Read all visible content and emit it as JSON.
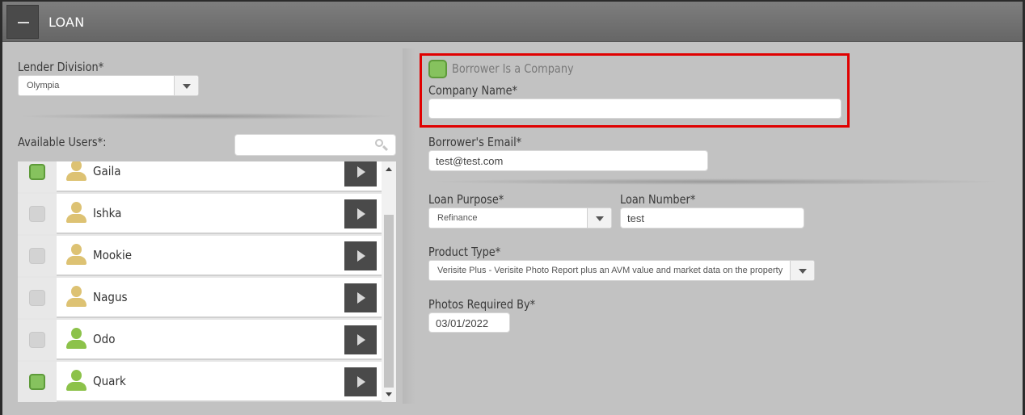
{
  "header": {
    "title": "LOAN",
    "collapse_icon": "minus-icon"
  },
  "lender_division": {
    "label": "Lender Division*",
    "value": "Olympia"
  },
  "available_users": {
    "label": "Available Users*:",
    "search_placeholder": "",
    "users": [
      {
        "name": "Gaila",
        "checked": true,
        "icon_color": "tan"
      },
      {
        "name": "Ishka",
        "checked": false,
        "icon_color": "tan"
      },
      {
        "name": "Mookie",
        "checked": false,
        "icon_color": "tan"
      },
      {
        "name": "Nagus",
        "checked": false,
        "icon_color": "tan"
      },
      {
        "name": "Odo",
        "checked": false,
        "icon_color": "green"
      },
      {
        "name": "Quark",
        "checked": true,
        "icon_color": "green"
      }
    ]
  },
  "borrower_company": {
    "checkbox_label": "Borrower Is a Company",
    "checked": true
  },
  "company_name": {
    "label": "Company Name*",
    "value": ""
  },
  "borrower_email": {
    "label": "Borrower's Email*",
    "value": "test@test.com"
  },
  "loan_purpose": {
    "label": "Loan Purpose*",
    "value": "Refinance"
  },
  "loan_number": {
    "label": "Loan Number*",
    "value": "test"
  },
  "product_type": {
    "label": "Product Type*",
    "value": "Verisite Plus - Verisite Photo Report plus an AVM value and market data on the property"
  },
  "photos_required_by": {
    "label": "Photos Required By*",
    "value": "03/01/2022"
  },
  "colors": {
    "highlight": "#e00000",
    "checked_green": "#86c25e",
    "header_gray": "#6f6f6f"
  }
}
